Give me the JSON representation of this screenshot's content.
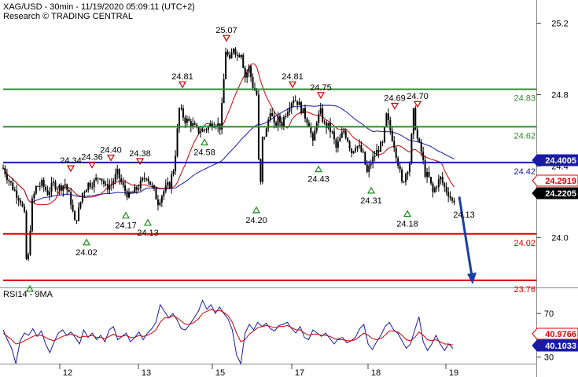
{
  "header": {
    "line1": "XAG/USD - 30min - 11/19/2020 05:09:11 (UTC+2)",
    "line2": "Research © TRADING CENTRAL"
  },
  "colors": {
    "resistance": "#2e8b2e",
    "pivot": "#1a1aa6",
    "support": "#dd0000",
    "price": "#000000",
    "ma_fast": "#cc0000",
    "ma_slow": "#1a1aa6",
    "rsi": "#1a1aa6",
    "rsi_ma": "#cc0000",
    "arrow": "#1a3fa6",
    "marker": "#1a8a1a",
    "marker_top": "#cc0000"
  },
  "chart_data": [
    {
      "type": "candlestick",
      "title": "XAG/USD - 30min - 11/19/2020 05:09:11 (UTC+2)",
      "x_tick_labels": [
        "12",
        "13",
        "15",
        "17",
        "18",
        "19"
      ],
      "x_ticks_day_index": [
        0,
        1,
        2,
        3,
        4,
        5
      ],
      "y_ticks": [
        24.0,
        24.4,
        24.8,
        25.2
      ],
      "ylim": [
        23.72,
        25.33
      ],
      "levels": [
        {
          "label": "24.83",
          "value": 24.83,
          "role": "resistance"
        },
        {
          "label": "24.62",
          "value": 24.62,
          "role": "resistance"
        },
        {
          "label": "24.42",
          "value": 24.42,
          "role": "pivot"
        },
        {
          "label": "24.02",
          "value": 24.02,
          "role": "support"
        },
        {
          "label": "23.76",
          "value": 23.76,
          "role": "support"
        }
      ],
      "price_boxes": [
        {
          "label": "24.4005",
          "value": 24.4005,
          "style": "blue"
        },
        {
          "label": "24.2919",
          "value": 24.2919,
          "style": "red-outline"
        },
        {
          "label": "24.2205",
          "value": 24.2205,
          "style": "black"
        }
      ],
      "close_path": [
        [
          0,
          24.39
        ],
        [
          1.5,
          24.32
        ],
        [
          3,
          24.26
        ],
        [
          4.5,
          24.21
        ],
        [
          5.5,
          24.12
        ],
        [
          6.2,
          23.78
        ],
        [
          6.8,
          24.0
        ],
        [
          7.5,
          24.2
        ],
        [
          8.5,
          24.28
        ],
        [
          10,
          24.3
        ],
        [
          11.5,
          24.25
        ],
        [
          13,
          24.3
        ],
        [
          14.5,
          24.28
        ],
        [
          16,
          24.3
        ],
        [
          17.5,
          24.2
        ],
        [
          18.5,
          24.08
        ],
        [
          19.5,
          24.15
        ],
        [
          20.5,
          24.25
        ],
        [
          22,
          24.3
        ],
        [
          23.5,
          24.31
        ],
        [
          25,
          24.35
        ],
        [
          26.5,
          24.28
        ],
        [
          28,
          24.3
        ],
        [
          29.5,
          24.36
        ],
        [
          31,
          24.28
        ],
        [
          32.5,
          24.23
        ],
        [
          34,
          24.26
        ],
        [
          35.5,
          24.3
        ],
        [
          37,
          24.35
        ],
        [
          38.5,
          24.28
        ],
        [
          40,
          24.2
        ],
        [
          41.5,
          24.26
        ],
        [
          43,
          24.3
        ],
        [
          44.2,
          24.4
        ],
        [
          45.5,
          24.72
        ],
        [
          47,
          24.66
        ],
        [
          48.5,
          24.64
        ],
        [
          50,
          24.6
        ],
        [
          51.5,
          24.6
        ],
        [
          53,
          24.62
        ],
        [
          54.5,
          24.65
        ],
        [
          56,
          24.62
        ],
        [
          56.6,
          24.75
        ],
        [
          57.5,
          25.05
        ],
        [
          58.5,
          24.98
        ],
        [
          59.5,
          25.07
        ],
        [
          60.5,
          25.02
        ],
        [
          61.5,
          25.04
        ],
        [
          62.5,
          24.9
        ],
        [
          63.5,
          24.95
        ],
        [
          64.5,
          24.85
        ],
        [
          65.5,
          24.8
        ],
        [
          66.3,
          24.2
        ],
        [
          67,
          24.55
        ],
        [
          68,
          24.6
        ],
        [
          69,
          24.72
        ],
        [
          70,
          24.62
        ],
        [
          71,
          24.66
        ],
        [
          72,
          24.64
        ],
        [
          73,
          24.7
        ],
        [
          74,
          24.75
        ],
        [
          75,
          24.78
        ],
        [
          76,
          24.76
        ],
        [
          77,
          24.72
        ],
        [
          78,
          24.68
        ],
        [
          79,
          24.64
        ],
        [
          80,
          24.52
        ],
        [
          81,
          24.66
        ],
        [
          82,
          24.7
        ],
        [
          83,
          24.63
        ],
        [
          84,
          24.62
        ],
        [
          85,
          24.58
        ],
        [
          86,
          24.5
        ],
        [
          87,
          24.55
        ],
        [
          88,
          24.6
        ],
        [
          89,
          24.55
        ],
        [
          90,
          24.48
        ],
        [
          91,
          24.52
        ],
        [
          92,
          24.5
        ],
        [
          93,
          24.46
        ],
        [
          94,
          24.36
        ],
        [
          95,
          24.42
        ],
        [
          96,
          24.46
        ],
        [
          97,
          24.5
        ],
        [
          98,
          24.52
        ],
        [
          99,
          24.68
        ],
        [
          100,
          24.6
        ],
        [
          101,
          24.52
        ],
        [
          102,
          24.42
        ],
        [
          103,
          24.3
        ],
        [
          104,
          24.36
        ],
        [
          105,
          24.42
        ],
        [
          106,
          24.7
        ],
        [
          107,
          24.55
        ],
        [
          108,
          24.48
        ],
        [
          109,
          24.36
        ],
        [
          110,
          24.33
        ],
        [
          111,
          24.25
        ],
        [
          112,
          24.3
        ],
        [
          113,
          24.33
        ],
        [
          114,
          24.28
        ],
        [
          115,
          24.25
        ],
        [
          116,
          24.2
        ],
        [
          116.8,
          24.22
        ]
      ],
      "marker_labels": [
        {
          "label": "25.07",
          "kind": "top"
        },
        {
          "label": "24.81",
          "kind": "top"
        },
        {
          "label": "24.81",
          "kind": "top"
        },
        {
          "label": "24.75",
          "kind": "top"
        },
        {
          "label": "24.69",
          "kind": "top"
        },
        {
          "label": "24.70",
          "kind": "top"
        },
        {
          "label": "24.34",
          "kind": "top"
        },
        {
          "label": "24.36",
          "kind": "top"
        },
        {
          "label": "24.40",
          "kind": "top"
        },
        {
          "label": "24.38",
          "kind": "top"
        },
        {
          "label": "24.58",
          "kind": "bottom"
        },
        {
          "label": "24.43",
          "kind": "bottom"
        },
        {
          "label": "24.31",
          "kind": "bottom"
        },
        {
          "label": "24.18",
          "kind": "bottom"
        },
        {
          "label": "24.20",
          "kind": "bottom"
        },
        {
          "label": "24.17",
          "kind": "bottom"
        },
        {
          "label": "24.13",
          "kind": "bottom"
        },
        {
          "label": "24.02",
          "kind": "bottom"
        },
        {
          "label": "24.13",
          "kind": "target"
        }
      ],
      "projection": {
        "from": 24.22,
        "to": 23.76,
        "direction": "down"
      }
    },
    {
      "type": "line",
      "title": "RSI14 - 9MA",
      "y_ticks": [
        30,
        70
      ],
      "ylim": [
        24,
        91
      ],
      "series": [
        {
          "name": "RSI14",
          "values": [
            55,
            46,
            38,
            24,
            45,
            52,
            50,
            56,
            49,
            54,
            42,
            34,
            44,
            52,
            55,
            50,
            53,
            48,
            42,
            55,
            48,
            52,
            46,
            50,
            44,
            55,
            58,
            46,
            49,
            52,
            44,
            48,
            53,
            46,
            52,
            56,
            62,
            78,
            72,
            66,
            70,
            64,
            56,
            55,
            60,
            66,
            72,
            82,
            74,
            78,
            70,
            76,
            70,
            65,
            55,
            32,
            24,
            52,
            60,
            55,
            62,
            58,
            61,
            56,
            54,
            59,
            60,
            62,
            56,
            52,
            58,
            48,
            46,
            55,
            52,
            49,
            52,
            47,
            42,
            47,
            48,
            43,
            45,
            48,
            56,
            60,
            42,
            37,
            44,
            50,
            58,
            62,
            55,
            52,
            45,
            38,
            42,
            55,
            67,
            44,
            36,
            42,
            50,
            42,
            36,
            42,
            38
          ]
        },
        {
          "name": "9MA",
          "values": [
            52,
            49,
            46,
            42,
            43,
            45,
            47,
            49,
            50,
            50,
            48,
            46,
            45,
            47,
            49,
            50,
            51,
            50,
            48,
            49,
            49,
            50,
            48,
            48,
            47,
            49,
            51,
            49,
            49,
            50,
            48,
            48,
            50,
            49,
            50,
            52,
            55,
            62,
            66,
            66,
            68,
            66,
            63,
            60,
            60,
            62,
            65,
            70,
            72,
            74,
            72,
            73,
            71,
            68,
            62,
            52,
            44,
            46,
            51,
            54,
            57,
            58,
            59,
            58,
            57,
            58,
            58,
            59,
            57,
            55,
            55,
            52,
            50,
            51,
            51,
            50,
            50,
            49,
            47,
            46,
            46,
            45,
            45,
            46,
            49,
            52,
            50,
            47,
            46,
            47,
            50,
            54,
            54,
            53,
            50,
            46,
            45,
            48,
            53,
            50,
            46,
            45,
            46,
            44,
            42,
            42,
            41
          ]
        }
      ],
      "value_boxes": [
        {
          "label": "40.9766",
          "style": "red-outline"
        },
        {
          "label": "40.1033",
          "style": "blue"
        }
      ]
    }
  ]
}
